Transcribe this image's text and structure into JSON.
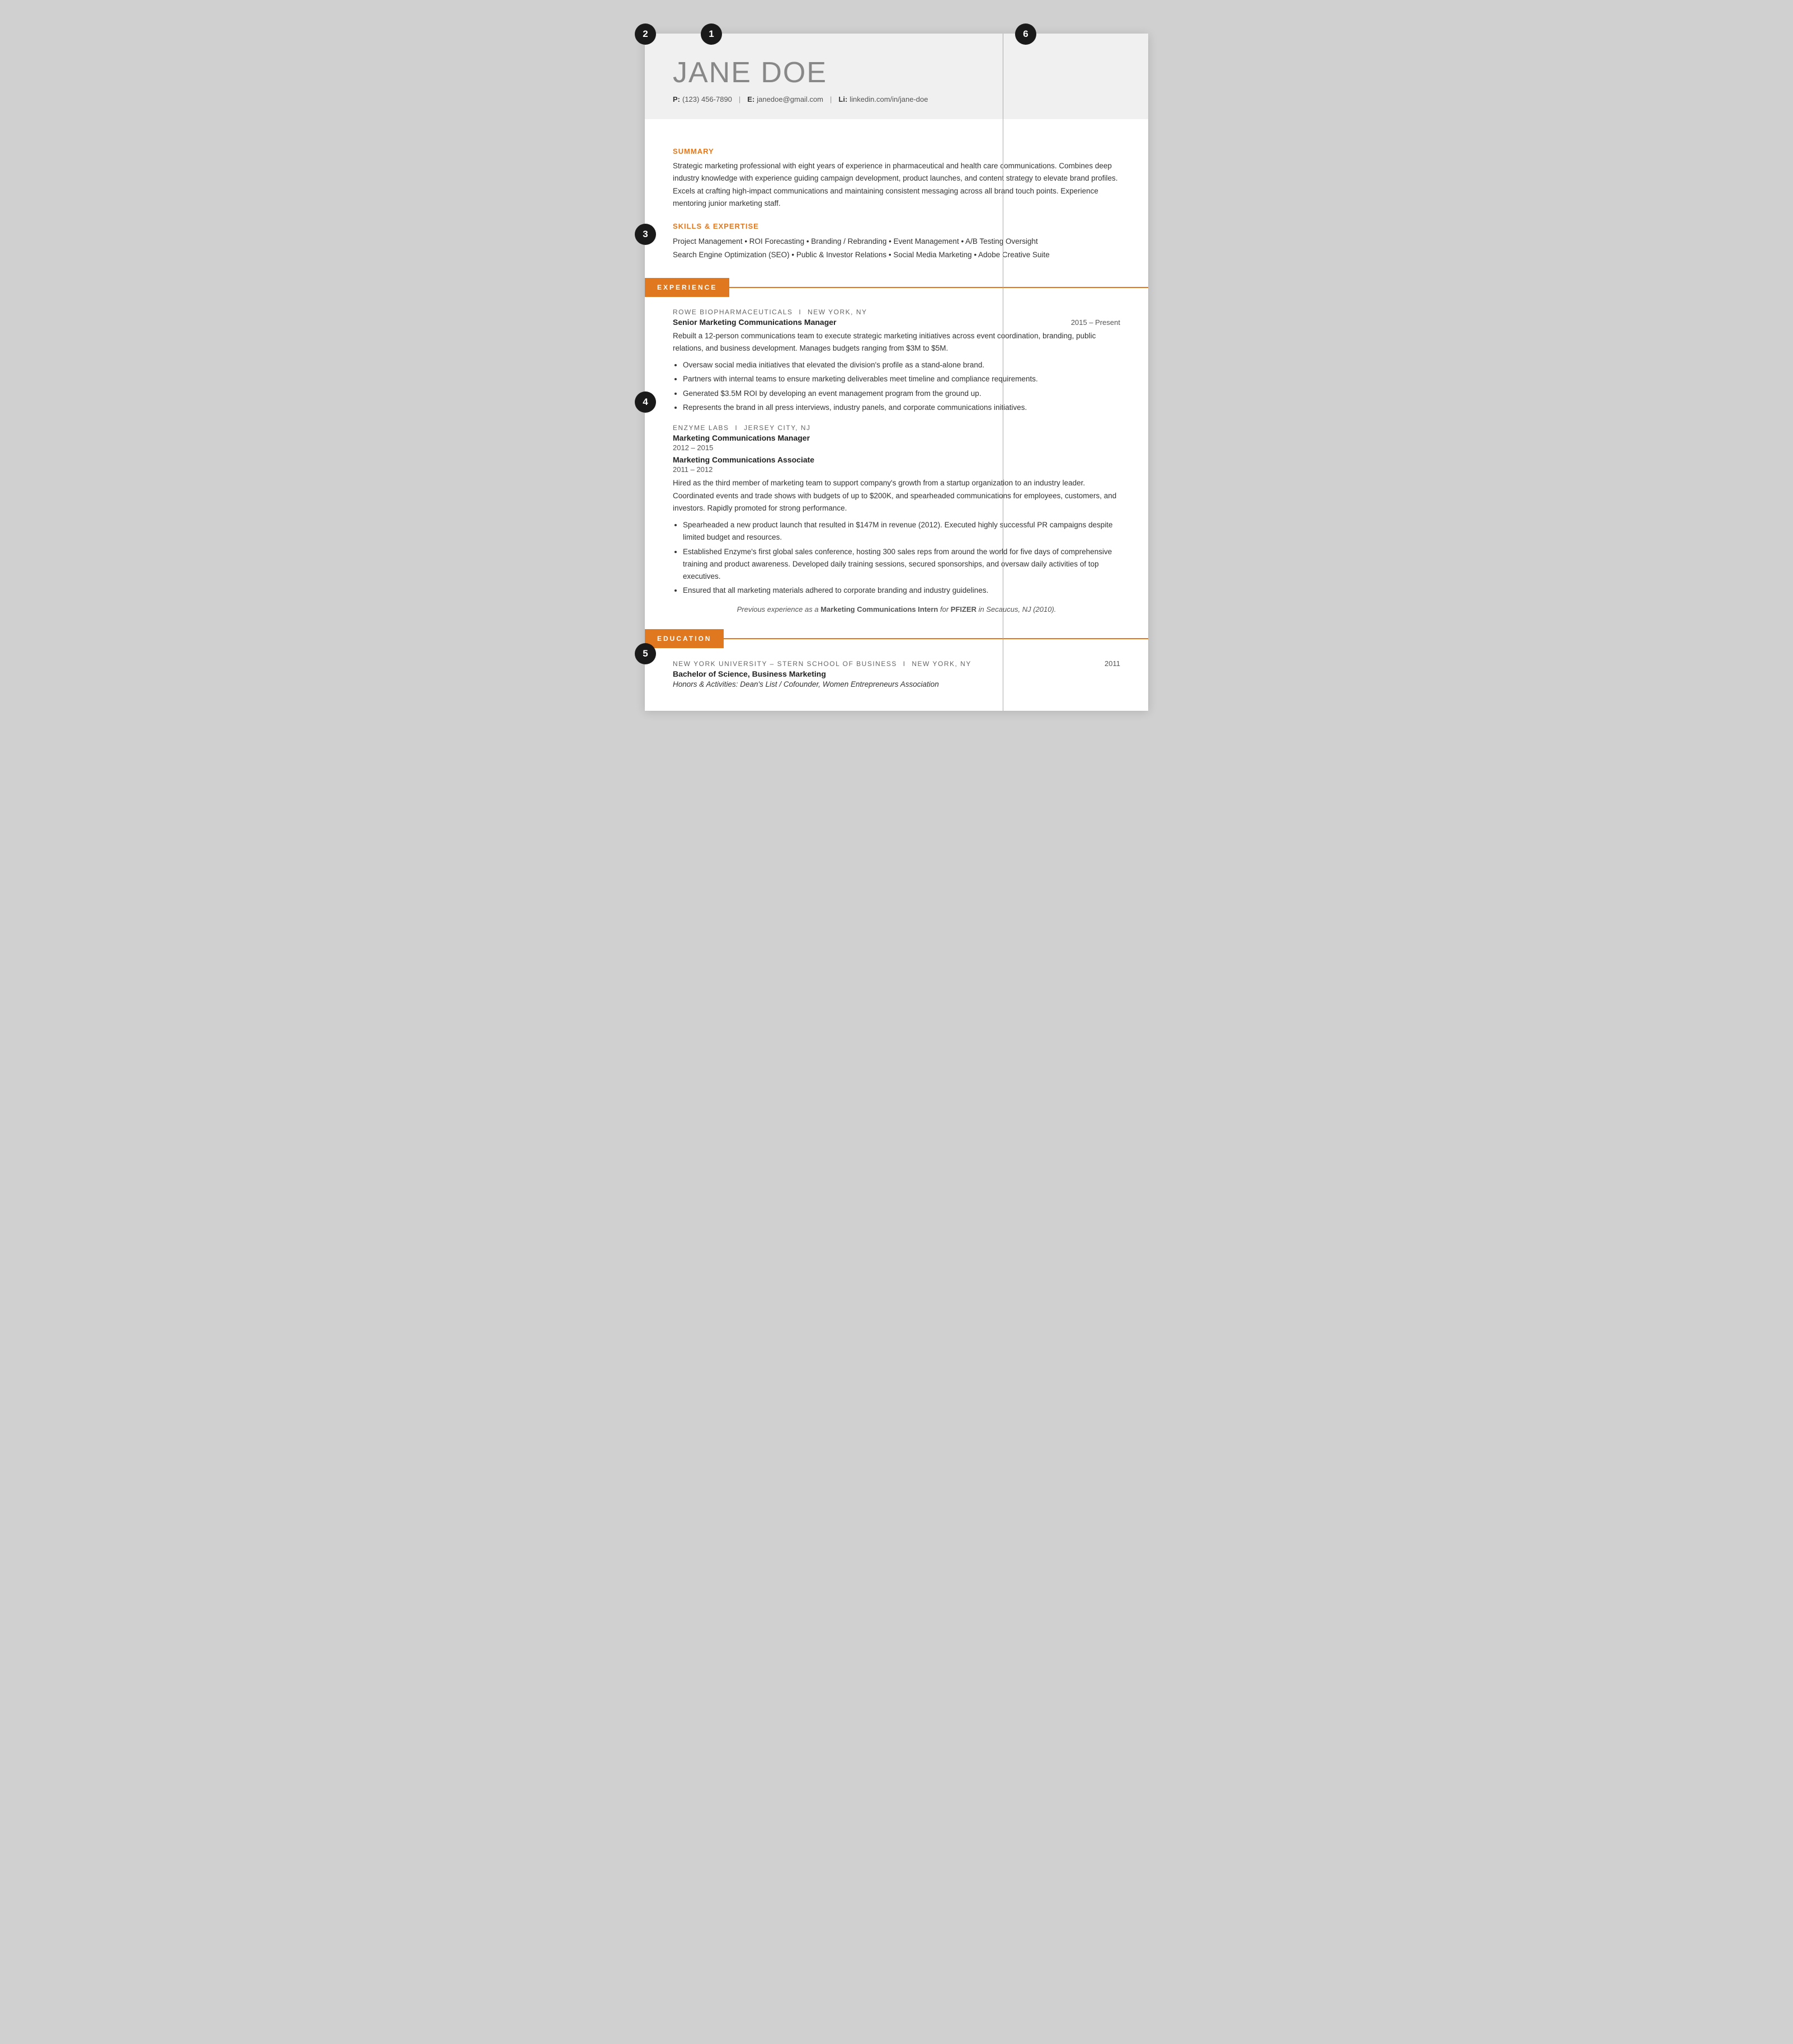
{
  "annotations": {
    "1": "1",
    "2": "2",
    "3": "3",
    "4": "4",
    "5": "5",
    "6": "6"
  },
  "header": {
    "name": "JANE DOE",
    "phone_label": "P:",
    "phone": "(123) 456-7890",
    "email_label": "E:",
    "email": "janedoe@gmail.com",
    "linkedin_label": "Li:",
    "linkedin": "linkedin.com/in/jane-doe"
  },
  "summary": {
    "heading": "SUMMARY",
    "text": "Strategic marketing professional with eight years of experience in pharmaceutical and health care communications. Combines deep industry knowledge with experience guiding campaign development, product launches, and content strategy to elevate brand profiles. Excels at crafting high-impact communications and maintaining consistent messaging across all brand touch points. Experience mentoring junior marketing staff."
  },
  "skills": {
    "heading": "SKILLS & EXPERTISE",
    "line1": "Project Management  •  ROI Forecasting  •  Branding / Rebranding  •  Event Management  •  A/B Testing Oversight",
    "line2": "Search Engine Optimization (SEO)  •  Public & Investor Relations  •  Social Media Marketing  •  Adobe Creative Suite"
  },
  "experience": {
    "heading": "EXPERIENCE",
    "jobs": [
      {
        "company": "ROWE BIOPHARMACEUTICALS",
        "location": "New York, NY",
        "title": "Senior Marketing Communications Manager",
        "date": "2015 – Present",
        "desc": "Rebuilt a 12-person communications team to execute strategic marketing initiatives across event coordination, branding, public relations, and business development. Manages budgets ranging from $3M to $5M.",
        "bullets": [
          "Oversaw social media initiatives that elevated the division's profile as a stand-alone brand.",
          "Partners with internal teams to ensure marketing deliverables meet timeline and compliance requirements.",
          "Generated $3.5M ROI by developing an event management program from the ground up.",
          "Represents the brand in all press interviews, industry panels, and corporate communications initiatives."
        ]
      },
      {
        "company": "ENZYME LABS",
        "location": "Jersey City, NJ",
        "title": "Marketing Communications Manager",
        "date": "2012 – 2015",
        "title2": "Marketing Communications Associate",
        "date2": "2011 – 2012",
        "desc": "Hired as the third member of marketing team to support company's growth from a startup organization to an industry leader. Coordinated events and trade shows with budgets of up to $200K, and spearheaded communications for employees, customers, and investors. Rapidly promoted for strong performance.",
        "bullets": [
          "Spearheaded a new product launch that resulted in $147M in revenue (2012). Executed highly successful PR campaigns despite limited budget and resources.",
          "Established Enzyme's first global sales conference, hosting 300 sales reps from around the world for five days of comprehensive training and product awareness. Developed daily training sessions, secured sponsorships, and oversaw daily activities of top executives.",
          "Ensured that all marketing materials adhered to corporate branding and industry guidelines."
        ]
      }
    ],
    "previous_note": "Previous experience as a Marketing Communications Intern for PFIZER in Secaucus, NJ (2010)."
  },
  "education": {
    "heading": "EDUCATION",
    "entries": [
      {
        "school": "NEW YORK UNIVERSITY – STERN SCHOOL OF BUSINESS",
        "location": "New York, NY",
        "year": "2011",
        "degree": "Bachelor of Science, Business Marketing",
        "honors": "Honors & Activities: Dean's List / Cofounder, Women Entrepreneurs Association"
      }
    ]
  }
}
